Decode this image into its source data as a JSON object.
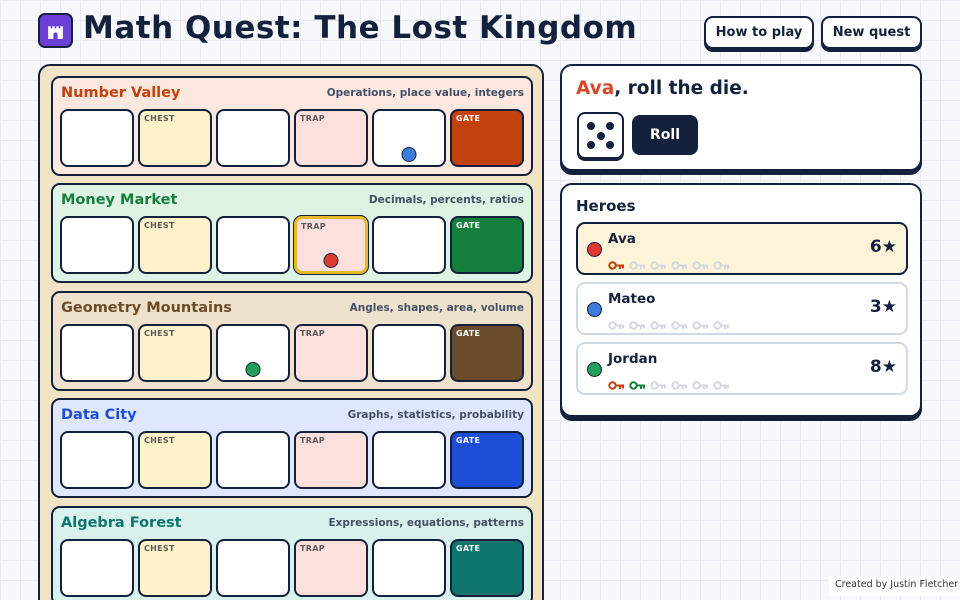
{
  "header": {
    "title": "Math Quest: The Lost Kingdom",
    "buttons": {
      "how_to_play": "How to play",
      "new_quest": "New quest"
    }
  },
  "board": {
    "regions": [
      {
        "name": "Number Valley",
        "subtitle": "Operations, place value, integers",
        "background": "#fde8df",
        "name_color": "#c2410c",
        "gate_color": "#c2410c",
        "tiles": [
          {
            "kind": "plain",
            "label": ""
          },
          {
            "kind": "chest",
            "label": "CHEST"
          },
          {
            "kind": "plain",
            "label": ""
          },
          {
            "kind": "trap",
            "label": "TRAP"
          },
          {
            "kind": "plain",
            "label": ""
          },
          {
            "kind": "gate",
            "label": "GATE"
          }
        ]
      },
      {
        "name": "Money Market",
        "subtitle": "Decimals, percents, ratios",
        "background": "#dff3e4",
        "name_color": "#15803d",
        "gate_color": "#15803d",
        "tiles": [
          {
            "kind": "plain",
            "label": ""
          },
          {
            "kind": "chest",
            "label": "CHEST"
          },
          {
            "kind": "plain",
            "label": ""
          },
          {
            "kind": "trap",
            "label": "TRAP"
          },
          {
            "kind": "plain",
            "label": ""
          },
          {
            "kind": "gate",
            "label": "GATE"
          }
        ]
      },
      {
        "name": "Geometry Mountains",
        "subtitle": "Angles, shapes, area, volume",
        "background": "#efe2cd",
        "name_color": "#6b4c2a",
        "gate_color": "#6b4c2a",
        "tiles": [
          {
            "kind": "plain",
            "label": ""
          },
          {
            "kind": "chest",
            "label": "CHEST"
          },
          {
            "kind": "plain",
            "label": ""
          },
          {
            "kind": "trap",
            "label": "TRAP"
          },
          {
            "kind": "plain",
            "label": ""
          },
          {
            "kind": "gate",
            "label": "GATE"
          }
        ]
      },
      {
        "name": "Data City",
        "subtitle": "Graphs, statistics, probability",
        "background": "#dee7fb",
        "name_color": "#1d4ed8",
        "gate_color": "#1d4ed8",
        "tiles": [
          {
            "kind": "plain",
            "label": ""
          },
          {
            "kind": "chest",
            "label": "CHEST"
          },
          {
            "kind": "plain",
            "label": ""
          },
          {
            "kind": "trap",
            "label": "TRAP"
          },
          {
            "kind": "plain",
            "label": ""
          },
          {
            "kind": "gate",
            "label": "GATE"
          }
        ]
      },
      {
        "name": "Algebra Forest",
        "subtitle": "Expressions, equations, patterns",
        "background": "#d8f1ec",
        "name_color": "#0f766e",
        "gate_color": "#0f766e",
        "tiles": [
          {
            "kind": "plain",
            "label": ""
          },
          {
            "kind": "chest",
            "label": "CHEST"
          },
          {
            "kind": "plain",
            "label": ""
          },
          {
            "kind": "trap",
            "label": "TRAP"
          },
          {
            "kind": "plain",
            "label": ""
          },
          {
            "kind": "gate",
            "label": "GATE"
          }
        ]
      }
    ],
    "current_tile": {
      "region": 1,
      "tile": 3
    }
  },
  "turn": {
    "player": "Ava",
    "prompt": ", roll the die.",
    "die_value": 5,
    "roll_label": "Roll"
  },
  "heroes": {
    "title": "Heroes",
    "key_total": 6,
    "players": [
      {
        "name": "Ava",
        "color": "#dc3b2f",
        "stars": "6★",
        "active": true,
        "position": {
          "region": 1,
          "tile": 3
        },
        "keys": [
          "#c2410c"
        ]
      },
      {
        "name": "Mateo",
        "color": "#3b7dd8",
        "stars": "3★",
        "active": false,
        "position": {
          "region": 0,
          "tile": 4
        },
        "keys": []
      },
      {
        "name": "Jordan",
        "color": "#22a05a",
        "stars": "8★",
        "active": false,
        "position": {
          "region": 2,
          "tile": 2
        },
        "keys": [
          "#c2410c",
          "#15803d"
        ]
      }
    ]
  },
  "credit": "Created by Justin Fletcher",
  "icons": {
    "logo": "castle-icon",
    "key": "key-icon",
    "die": "die-icon"
  }
}
